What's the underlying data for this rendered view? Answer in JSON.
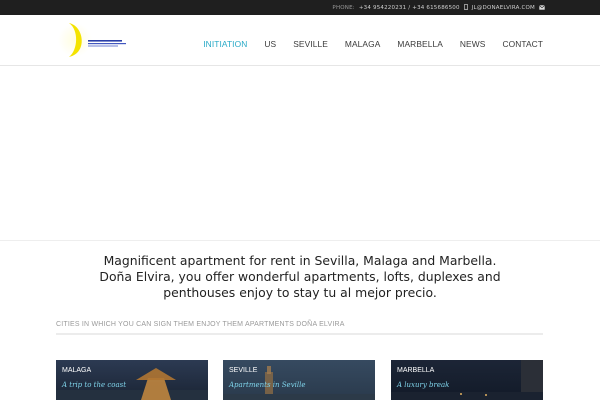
{
  "topbar": {
    "phone_label": "PHONE:",
    "phone_numbers": "+34 954220231 / +34 615686500",
    "email": "JL@DONAELVIRA.COM",
    "icons": [
      "mobile-icon",
      "envelope-icon"
    ]
  },
  "header": {
    "nav": [
      {
        "label": "INITIATION",
        "active": true
      },
      {
        "label": "US"
      },
      {
        "label": "SEVILLE"
      },
      {
        "label": "MALAGA"
      },
      {
        "label": "MARBELLA"
      },
      {
        "label": "NEWS"
      },
      {
        "label": "CONTACT"
      }
    ],
    "accent": "#27a9c7"
  },
  "intro": {
    "line1": "Magnificent apartment for rent in Sevilla, Malaga and Marbella.",
    "line2": "Doña Elvira, you offer wonderful apartments, lofts, duplexes and",
    "line3": "penthouses enjoy to stay tu al mejor precio."
  },
  "cities": {
    "title": "CITIES IN WHICH YOU CAN SIGN THEM ENJOY THEM APARTMENTS DOÑA ELVIRA",
    "cards": [
      {
        "name": "MALAGA",
        "tagline": "A trip to the coast"
      },
      {
        "name": "SEVILLE",
        "tagline": "Apartments in Seville"
      },
      {
        "name": "MARBELLA",
        "tagline": "A luxury break"
      }
    ]
  }
}
